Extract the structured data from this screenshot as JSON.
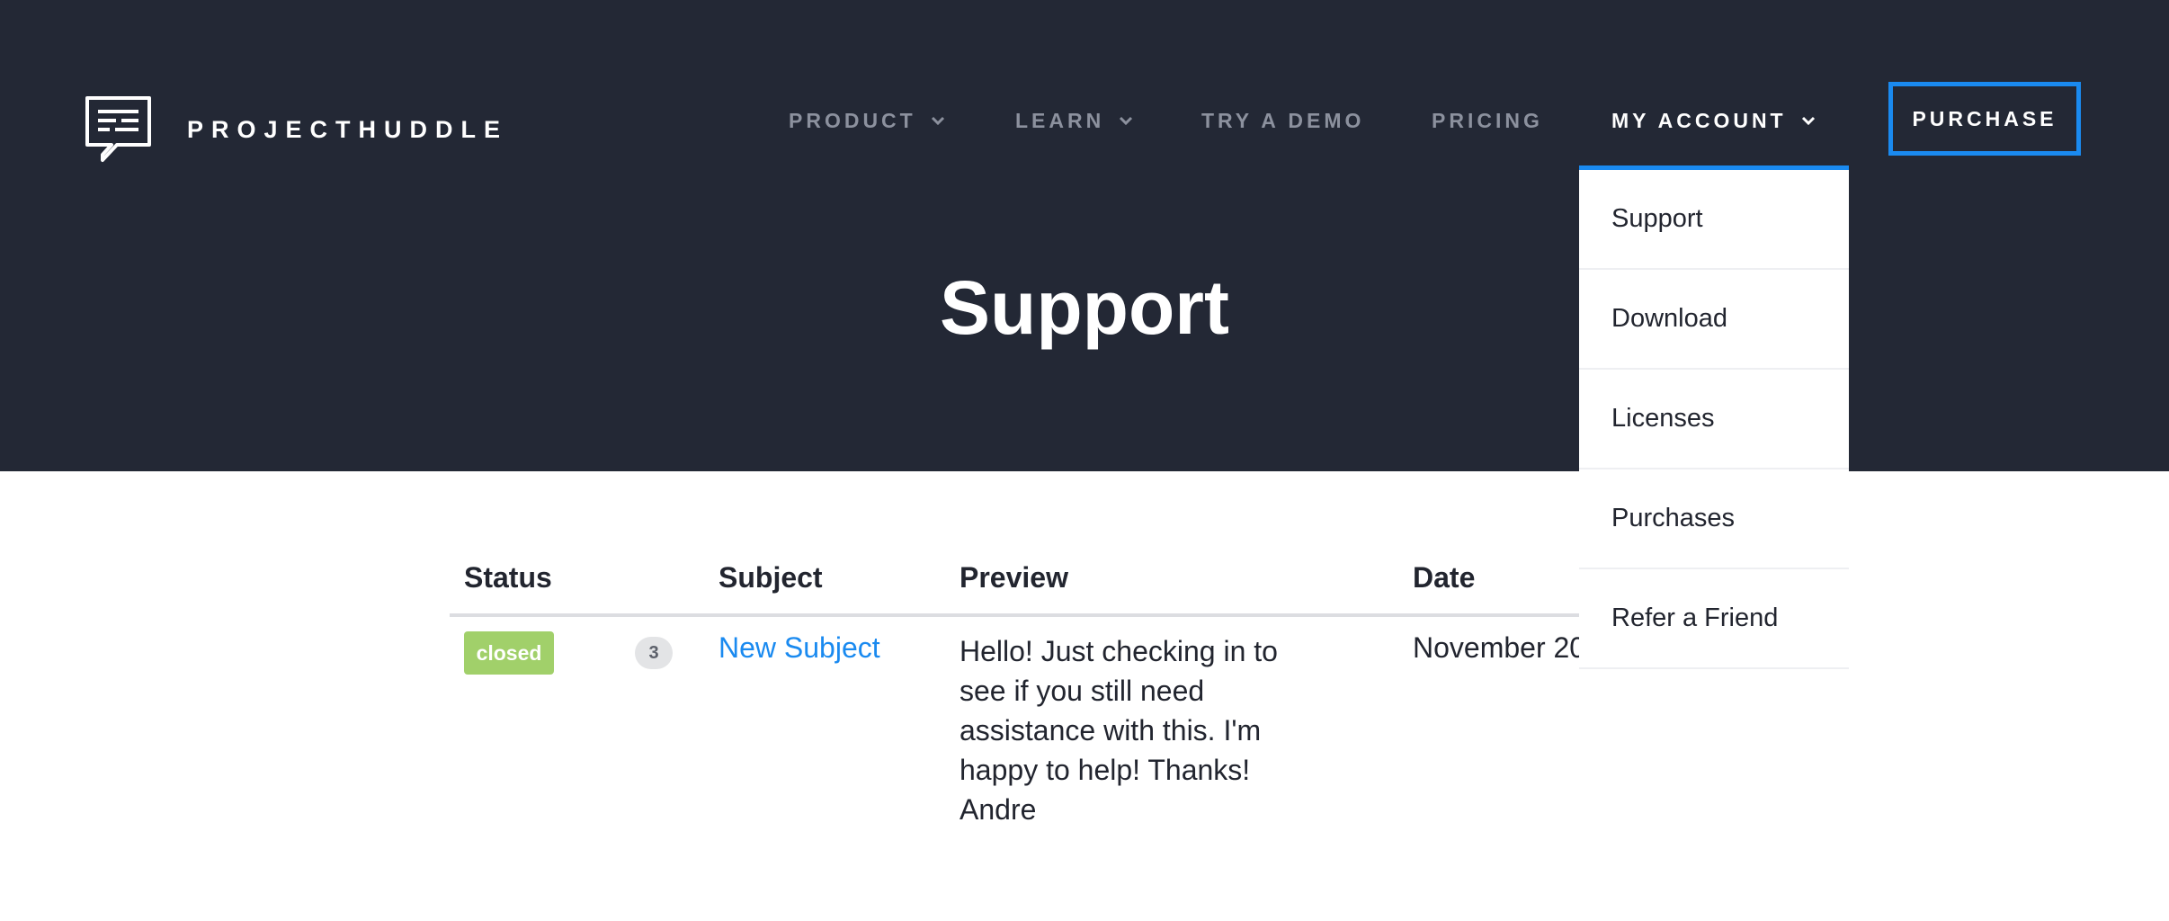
{
  "brand": {
    "name": "PROJECTHUDDLE"
  },
  "nav": {
    "items": [
      {
        "label": "PRODUCT",
        "has_dropdown": true
      },
      {
        "label": "LEARN",
        "has_dropdown": true
      },
      {
        "label": "TRY A DEMO",
        "has_dropdown": false
      },
      {
        "label": "PRICING",
        "has_dropdown": false
      },
      {
        "label": "MY ACCOUNT",
        "has_dropdown": true,
        "active": true
      }
    ],
    "purchase_label": "PURCHASE"
  },
  "account_menu": {
    "items": [
      "Support",
      "Download",
      "Licenses",
      "Purchases",
      "Refer a Friend"
    ]
  },
  "page": {
    "title": "Support"
  },
  "table": {
    "headers": {
      "status": "Status",
      "subject": "Subject",
      "preview": "Preview",
      "date": "Date"
    },
    "rows": [
      {
        "status": "closed",
        "reply_count": "3",
        "subject": "New Subject",
        "preview": "Hello! Just checking in to see if you still need assistance with this. I'm happy to help! Thanks! Andre",
        "date": "November 20"
      }
    ]
  },
  "colors": {
    "header_bg": "#232835",
    "accent": "#1a8af0",
    "status_closed": "#a1d06a",
    "nav_inactive": "#8c919e"
  }
}
